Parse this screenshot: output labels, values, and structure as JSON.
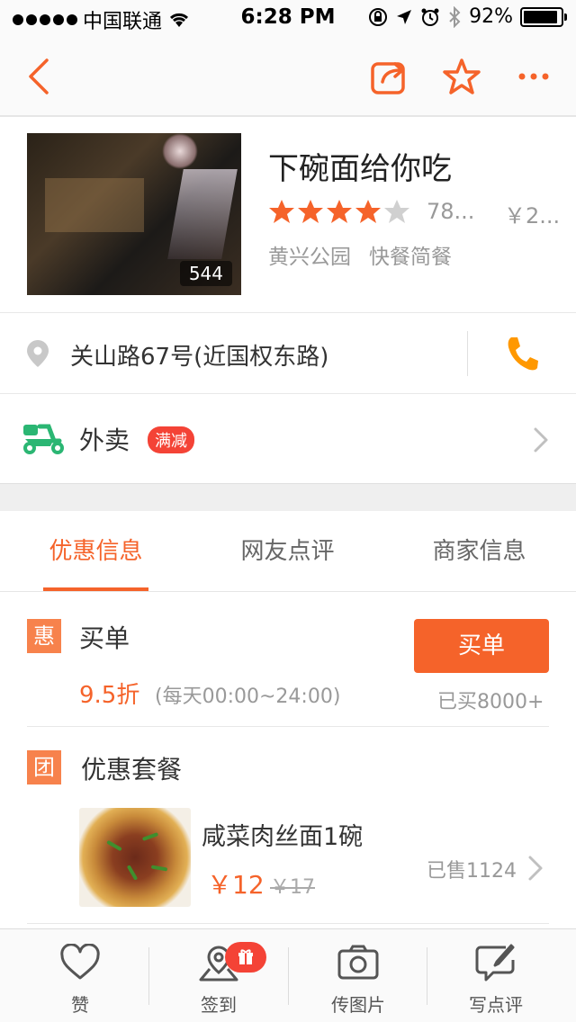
{
  "status_bar": {
    "carrier": "中国联通",
    "time": "6:28 PM",
    "battery": "92%",
    "battery_level": 0.92
  },
  "navbar": {
    "back_icon": "chevron-left-icon",
    "share_icon": "share-icon",
    "favorite_icon": "star-outline-icon",
    "more_icon": "more-dots-icon",
    "accent": "#f5632a"
  },
  "shop": {
    "name": "下碗面给你吃",
    "photo_count": "544",
    "rating": 4,
    "rating_max": 5,
    "reviews": "78...",
    "price": "￥2...",
    "area": "黄兴公园",
    "category": "快餐简餐"
  },
  "address": {
    "text": "关山路67号(近国权东路)",
    "pin_icon": "location-pin-icon",
    "phone_icon": "phone-icon"
  },
  "delivery": {
    "label": "外卖",
    "badge": "满减",
    "icon": "delivery-motorbike-icon"
  },
  "tabs": [
    {
      "label": "优惠信息",
      "active": true
    },
    {
      "label": "网友点评",
      "active": false
    },
    {
      "label": "商家信息",
      "active": false
    }
  ],
  "maidan": {
    "icon_text": "惠",
    "title": "买单",
    "discount": "9.5折",
    "hours": "(每天00:00~24:00)",
    "button": "买单",
    "bought": "已买8000+"
  },
  "package": {
    "icon_text": "团",
    "title": "优惠套餐",
    "item_name": "咸菜肉丝面1碗",
    "price": "￥12",
    "original_price": "￥17",
    "sold": "已售1124"
  },
  "bottom_bar": [
    {
      "label": "赞",
      "icon": "heart-icon"
    },
    {
      "label": "签到",
      "icon": "checkin-pin-icon"
    },
    {
      "label": "传图片",
      "icon": "camera-icon"
    },
    {
      "label": "写点评",
      "icon": "edit-review-icon"
    }
  ]
}
